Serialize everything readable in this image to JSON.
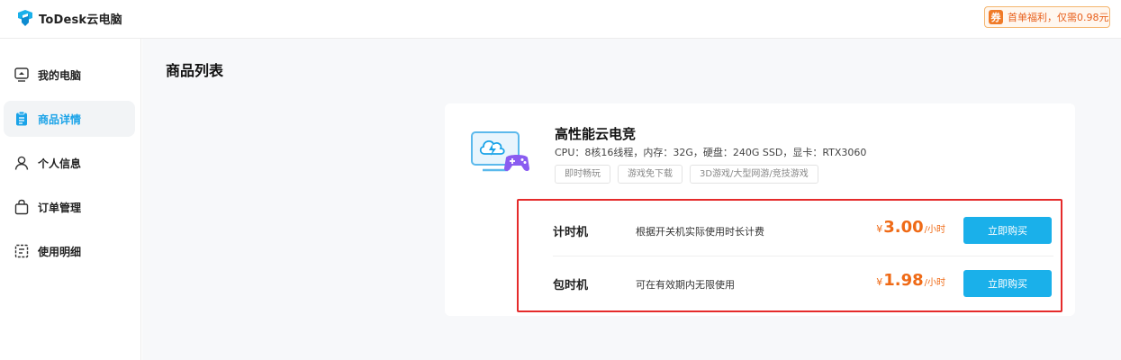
{
  "header": {
    "app_name": "ToDesk云电脑",
    "promo_icon_label": "券",
    "promo_text": "首单福利，仅需0.98元"
  },
  "sidebar": {
    "items": [
      {
        "label": "我的电脑",
        "icon": "monitor-icon",
        "active": false
      },
      {
        "label": "商品详情",
        "icon": "clipboard-icon",
        "active": true
      },
      {
        "label": "个人信息",
        "icon": "user-icon",
        "active": false
      },
      {
        "label": "订单管理",
        "icon": "bag-icon",
        "active": false
      },
      {
        "label": "使用明细",
        "icon": "list-icon",
        "active": false
      }
    ]
  },
  "main": {
    "title": "商品列表",
    "product": {
      "name": "高性能云电竞",
      "spec": "CPU：8核16线程，内存：32G，硬盘：240G SSD，显卡：RTX3060",
      "tags": [
        "即时畅玩",
        "游戏免下载",
        "3D游戏/大型网游/竞技游戏"
      ],
      "image": "cloud-gaming-monitor-icon"
    },
    "plans": [
      {
        "name": "计时机",
        "desc": "根据开关机实际使用时长计费",
        "currency": "¥",
        "price": "3.00",
        "unit": "/小时",
        "button": "立即购买"
      },
      {
        "name": "包时机",
        "desc": "可在有效期内无限使用",
        "currency": "¥",
        "price": "1.98",
        "unit": "/小时",
        "button": "立即购买"
      }
    ]
  },
  "colors": {
    "accent": "#1ab0ea",
    "price": "#ef6a16",
    "highlight_border": "#e52b2b",
    "promo": "#f07b28"
  }
}
